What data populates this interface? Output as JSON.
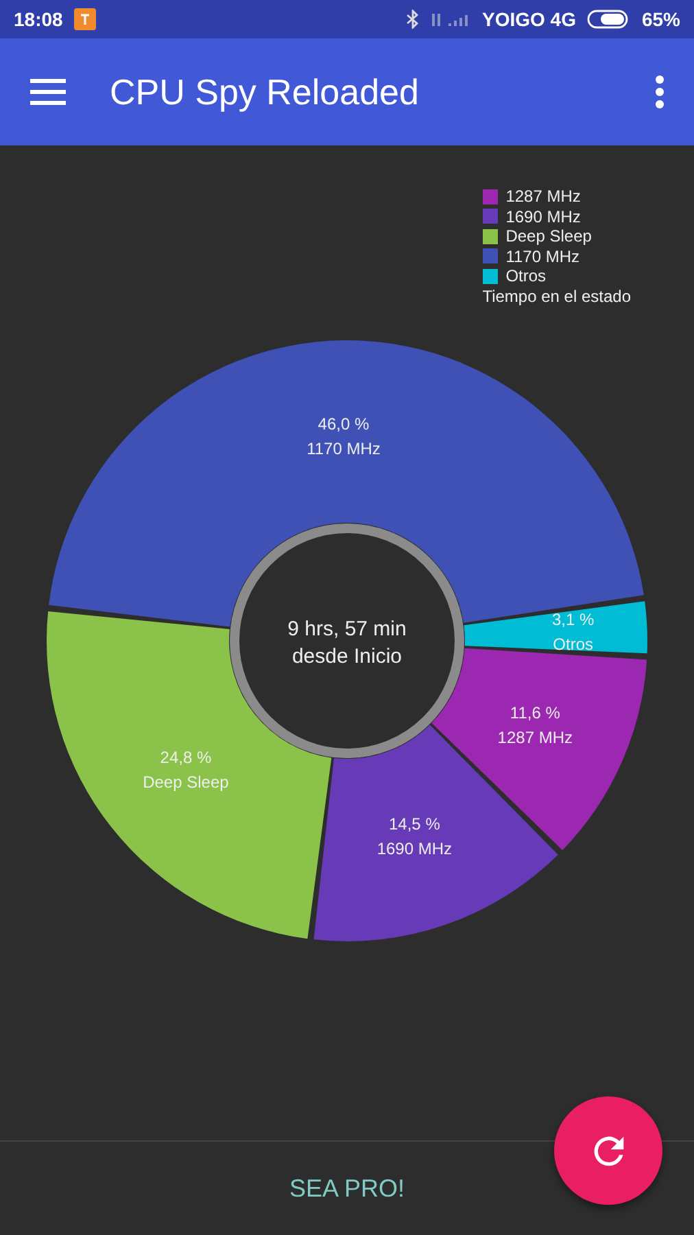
{
  "status_bar": {
    "time": "18:08",
    "carrier": "YOIGO 4G",
    "battery": "65%"
  },
  "app_bar": {
    "title": "CPU Spy Reloaded"
  },
  "chart": {
    "legend": [
      {
        "label": "1287 MHz",
        "color": "#9c27b0"
      },
      {
        "label": "1690 MHz",
        "color": "#673ab7"
      },
      {
        "label": "Deep Sleep",
        "color": "#8bc34a"
      },
      {
        "label": "1170 MHz",
        "color": "#3f51b5"
      },
      {
        "label": "Otros",
        "color": "#00bcd4"
      }
    ],
    "legend_title": "Tiempo en el estado",
    "center_text": [
      "9 hrs, 57 min",
      "desde Inicio"
    ],
    "chart_data": {
      "type": "donut",
      "categories": [
        "1287 MHz",
        "1690 MHz",
        "Deep Sleep",
        "1170 MHz",
        "Otros"
      ],
      "values": [
        11.6,
        14.5,
        24.8,
        46.0,
        3.1
      ],
      "value_labels": [
        "11,6 %",
        "14,5 %",
        "24,8 %",
        "46,0 %",
        "3,1 %"
      ]
    }
  },
  "bottom_bar": {
    "button": "SEA PRO!"
  }
}
